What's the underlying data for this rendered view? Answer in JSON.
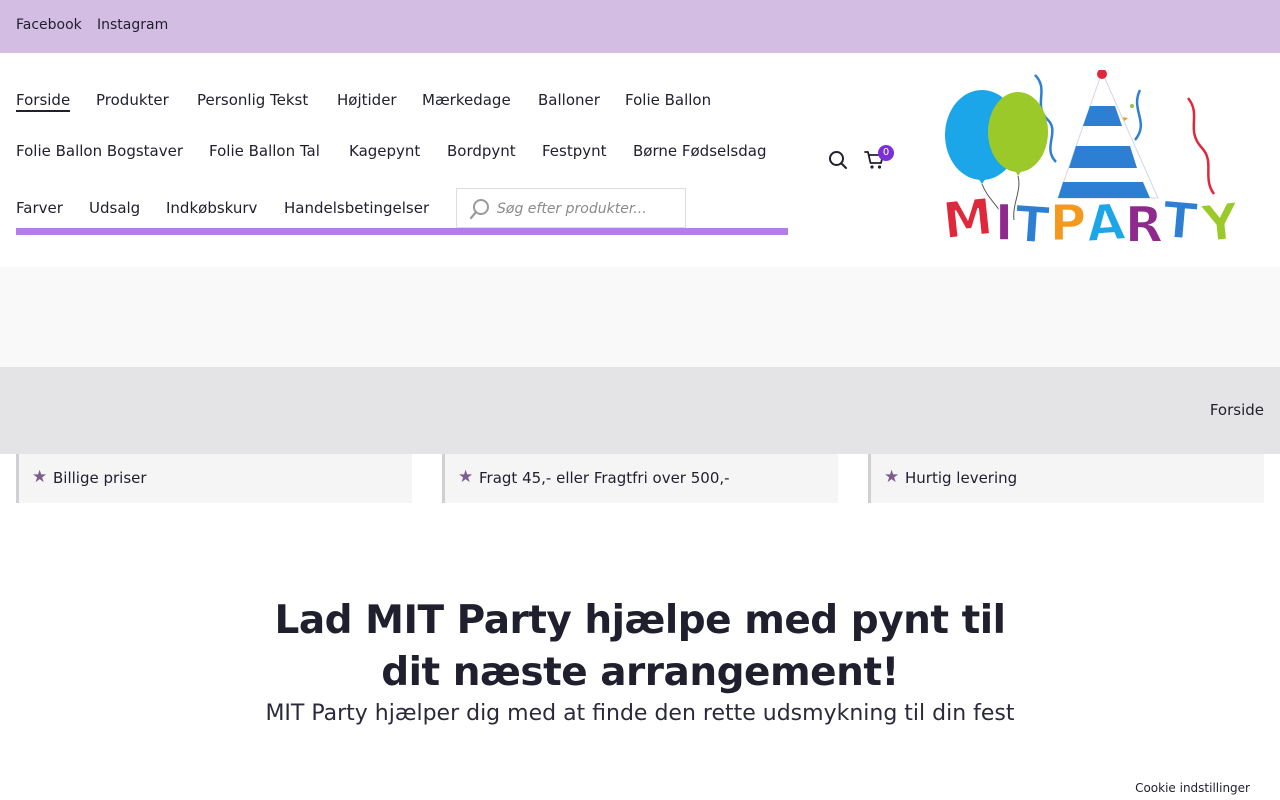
{
  "topbar": {
    "links": [
      "Facebook",
      "Instagram"
    ]
  },
  "nav": {
    "items": [
      "Forside",
      "Produkter",
      "Personlig Tekst",
      "Højtider",
      "Mærkedage",
      "Balloner",
      "Folie Ballon",
      "Folie Ballon Bogstaver",
      "Folie Ballon Tal",
      "Kagepynt",
      "Bordpynt",
      "Festpynt",
      "Børne Fødselsdag",
      "Farver",
      "Udsalg",
      "Indkøbskurv",
      "Handelsbetingelser"
    ],
    "active": "Forside"
  },
  "search": {
    "placeholder": "Søg efter produkter..."
  },
  "cart": {
    "count": "0"
  },
  "logo": {
    "text": "MITPARTY"
  },
  "breadcrumb": "Forside",
  "features": [
    "Billige priser",
    "Fragt 45,- eller Fragtfri over 500,-",
    "Hurtig levering"
  ],
  "hero": {
    "title": "Lad MIT Party hjælpe med pynt til dit næste arrangement!",
    "subtitle": "MIT Party hjælper dig med at finde den rette udsmykning til din fest"
  },
  "cookie": "Cookie indstillinger",
  "colors": {
    "topbar": "#d4bde3",
    "accent": "#b57ee6",
    "badge": "#7b2fd6",
    "star": "#7d5c8f"
  }
}
